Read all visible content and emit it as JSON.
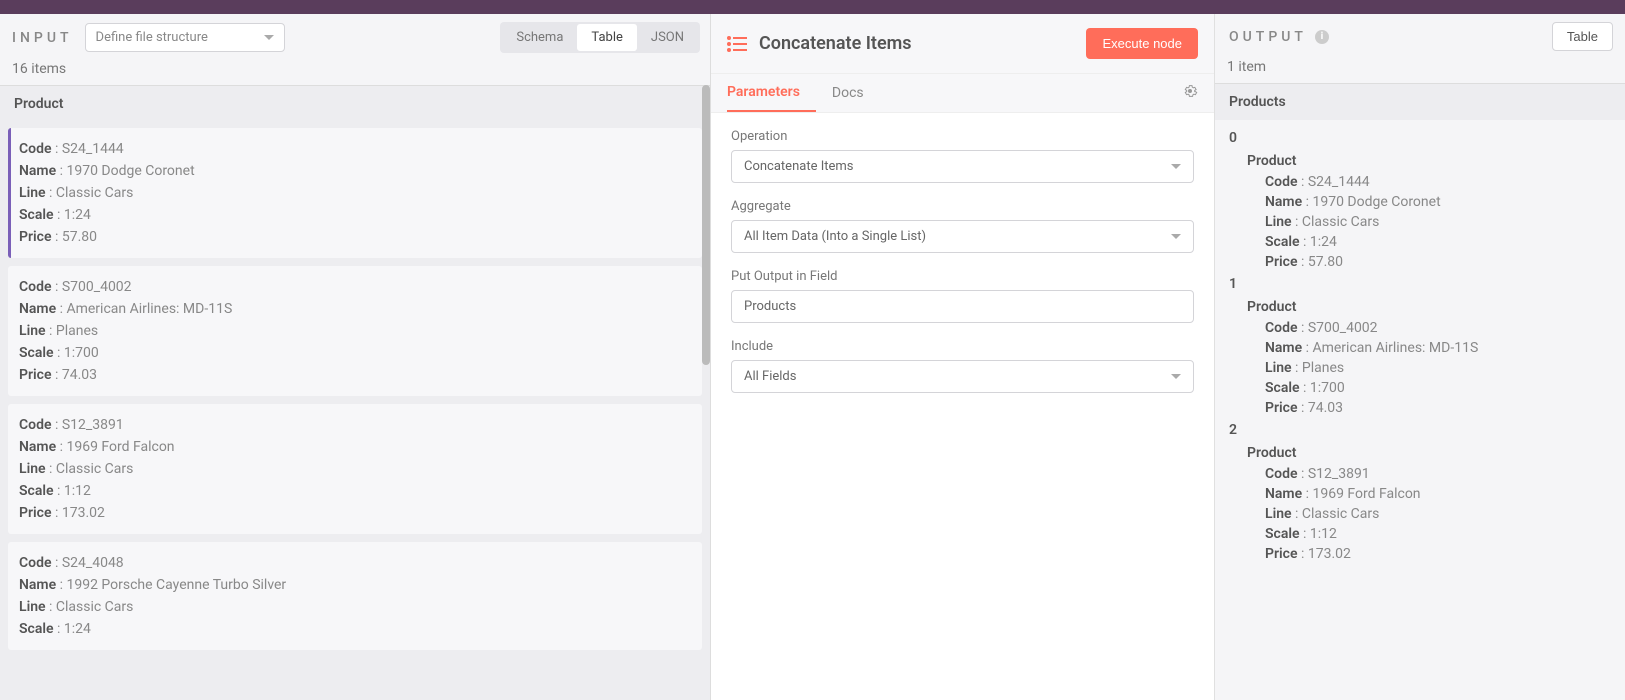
{
  "input": {
    "title": "INPUT",
    "selector_label": "Define file structure",
    "view_tabs": {
      "schema": "Schema",
      "table": "Table",
      "json": "JSON"
    },
    "count_text": "16 items",
    "column_header": "Product",
    "items": [
      {
        "Code": "S24_1444",
        "Name": "1970 Dodge Coronet",
        "Line": "Classic Cars",
        "Scale": "1:24",
        "Price": "57.80"
      },
      {
        "Code": "S700_4002",
        "Name": "American Airlines: MD-11S",
        "Line": "Planes",
        "Scale": "1:700",
        "Price": "74.03"
      },
      {
        "Code": "S12_3891",
        "Name": "1969 Ford Falcon",
        "Line": "Classic Cars",
        "Scale": "1:12",
        "Price": "173.02"
      },
      {
        "Code": "S24_4048",
        "Name": "1992 Porsche Cayenne Turbo Silver",
        "Line": "Classic Cars",
        "Scale": "1:24",
        "Price": ""
      }
    ],
    "field_labels": {
      "Code": "Code",
      "Name": "Name",
      "Line": "Line",
      "Scale": "Scale",
      "Price": "Price"
    }
  },
  "node": {
    "title": "Concatenate Items",
    "execute_label": "Execute node",
    "tabs": {
      "parameters": "Parameters",
      "docs": "Docs"
    },
    "params": {
      "operation": {
        "label": "Operation",
        "value": "Concatenate Items"
      },
      "aggregate": {
        "label": "Aggregate",
        "value": "All Item Data (Into a Single List)"
      },
      "put_output": {
        "label": "Put Output in Field",
        "value": "Products"
      },
      "include": {
        "label": "Include",
        "value": "All Fields"
      }
    }
  },
  "output": {
    "title": "OUTPUT",
    "table_btn": "Table",
    "count_text": "1 item",
    "column_header": "Products",
    "group_label": "Product",
    "field_labels": {
      "Code": "Code",
      "Name": "Name",
      "Line": "Line",
      "Scale": "Scale",
      "Price": "Price"
    },
    "groups": [
      {
        "idx": "0",
        "fields": {
          "Code": "S24_1444",
          "Name": "1970 Dodge Coronet",
          "Line": "Classic Cars",
          "Scale": "1:24",
          "Price": "57.80"
        }
      },
      {
        "idx": "1",
        "fields": {
          "Code": "S700_4002",
          "Name": "American Airlines: MD-11S",
          "Line": "Planes",
          "Scale": "1:700",
          "Price": "74.03"
        }
      },
      {
        "idx": "2",
        "fields": {
          "Code": "S12_3891",
          "Name": "1969 Ford Falcon",
          "Line": "Classic Cars",
          "Scale": "1:12",
          "Price": "173.02"
        }
      }
    ]
  }
}
